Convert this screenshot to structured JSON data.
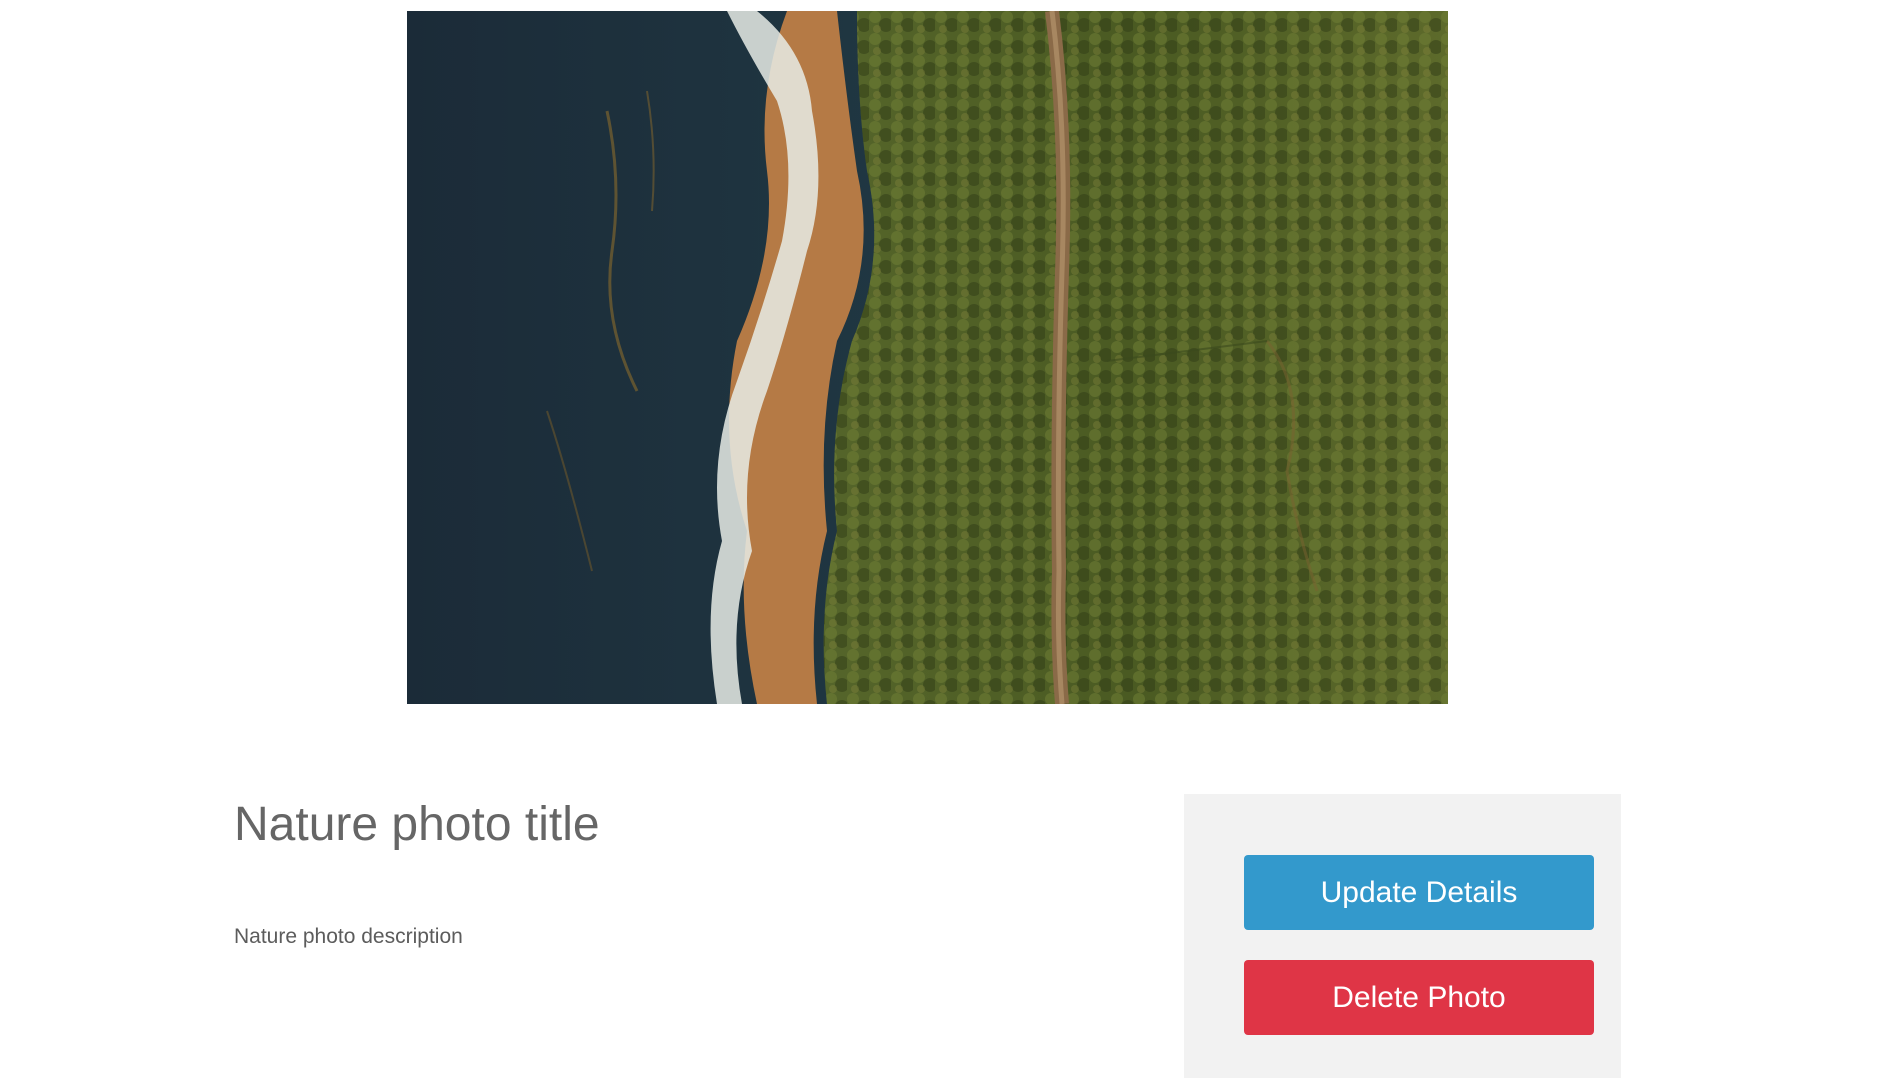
{
  "photo": {
    "alt": "Nature photo",
    "colors": {
      "ocean_deep": "#1d2f3c",
      "ocean_mid": "#223b45",
      "surf": "#e8ece6",
      "sand": "#b57a45",
      "forest_dark": "#3c4a1f",
      "forest_light": "#6b7a34",
      "road": "#8a6a48"
    }
  },
  "details": {
    "title": "Nature photo title",
    "description": "Nature photo description"
  },
  "actions": {
    "update_label": "Update Details",
    "delete_label": "Delete Photo",
    "update_color": "#3399cc",
    "delete_color": "#df3546"
  }
}
